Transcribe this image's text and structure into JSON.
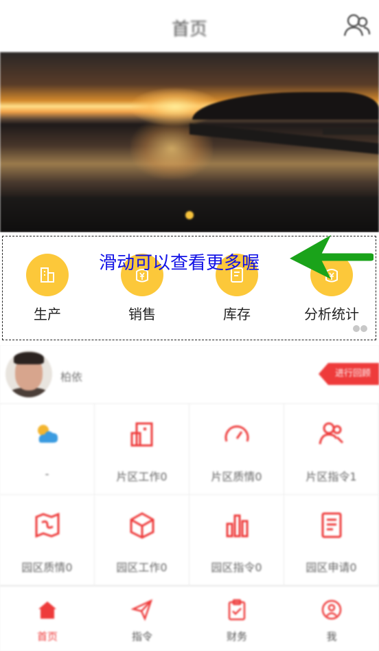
{
  "header": {
    "title": "首页",
    "user_icon": "users-icon"
  },
  "banner": {
    "slide_count": 1,
    "active_slide": 1
  },
  "menu": {
    "items": [
      {
        "label": "生产",
        "icon": "building-icon",
        "color": "#fcc83a"
      },
      {
        "label": "销售",
        "icon": "yen-bag-icon",
        "color": "#fcc83a"
      },
      {
        "label": "库存",
        "icon": "inventory-doc-icon",
        "color": "#fcc83a"
      },
      {
        "label": "分析统计",
        "icon": "yen-bag-icon",
        "color": "#fcc83a"
      }
    ],
    "hint": "滑动可以查看更多喔"
  },
  "profile": {
    "name": "柏依",
    "tag": "进行回顾"
  },
  "grid": {
    "items": [
      {
        "label": "-",
        "icon": "weather-icon"
      },
      {
        "label": "片区工作0",
        "icon": "building-icon"
      },
      {
        "label": "片区质情0",
        "icon": "gauge-icon"
      },
      {
        "label": "片区指令1",
        "icon": "people-icon"
      },
      {
        "label": "园区质情0",
        "icon": "map-icon"
      },
      {
        "label": "园区工作0",
        "icon": "cube-icon"
      },
      {
        "label": "园区指令0",
        "icon": "bar-chart-icon"
      },
      {
        "label": "园区申请0",
        "icon": "document-icon"
      }
    ]
  },
  "tabbar": {
    "items": [
      {
        "label": "首页",
        "icon": "home-icon",
        "active": true
      },
      {
        "label": "指令",
        "icon": "send-icon",
        "active": false
      },
      {
        "label": "财务",
        "icon": "clipboard-icon",
        "active": false
      },
      {
        "label": "我",
        "icon": "user-icon",
        "active": false
      }
    ]
  },
  "colors": {
    "accent": "#ee3b3b",
    "menu_circle": "#fcc83a",
    "hint": "#1212e6",
    "arrow": "#1aa31a"
  }
}
